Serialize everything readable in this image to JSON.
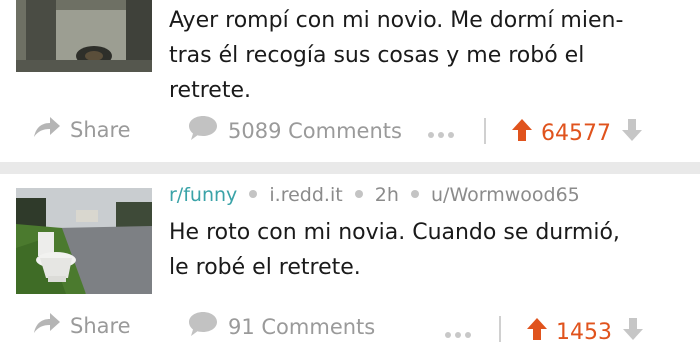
{
  "posts": [
    {
      "title": "Ayer rompí con mi novio. Me dormí mien-\ntras él recogía sus cosas y me robó el\nretrete.",
      "share_label": "Share",
      "comments_label": "5089 Comments",
      "score": "64577"
    },
    {
      "subreddit": "r/funny",
      "domain": "i.redd.it",
      "age": "2h",
      "author": "u/Wormwood65",
      "title": "He roto con mi novia. Cuando se durmió,\nle robé el retrete.",
      "share_label": "Share",
      "comments_label": "91 Comments",
      "score": "1453"
    }
  ],
  "colors": {
    "upvote": "#e0531d",
    "subreddit": "#3aa3a8",
    "muted": "#9a9a9a",
    "separator": "#e9e9e9"
  },
  "icons": [
    "share-arrow-icon",
    "comment-bubble-icon",
    "more-dots-icon",
    "upvote-arrow-icon",
    "downvote-arrow-icon"
  ]
}
